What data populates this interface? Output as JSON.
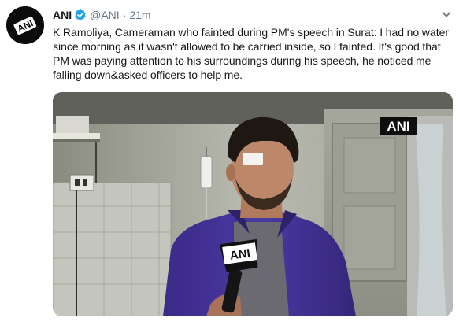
{
  "tweet": {
    "author_name": "ANI",
    "author_handle": "@ANI",
    "separator": "·",
    "timestamp": "21m",
    "text": "K Ramoliya, Cameraman who fainted during PM's speech in Surat: I had no water since morning as it wasn't allowed to be carried inside, so I fainted. It's good that PM was paying attention to his surroundings during his speech, he noticed me falling down&asked officers to help me."
  },
  "avatar": {
    "logo_text": "ANI"
  },
  "media": {
    "watermark": "ANI",
    "mic_flag": "ANI"
  },
  "icons": {
    "verified": "verified-badge-icon",
    "caret": "chevron-down-icon"
  },
  "colors": {
    "verified_blue": "#1da1f2",
    "secondary_text": "#657786",
    "primary_text": "#14171a"
  }
}
